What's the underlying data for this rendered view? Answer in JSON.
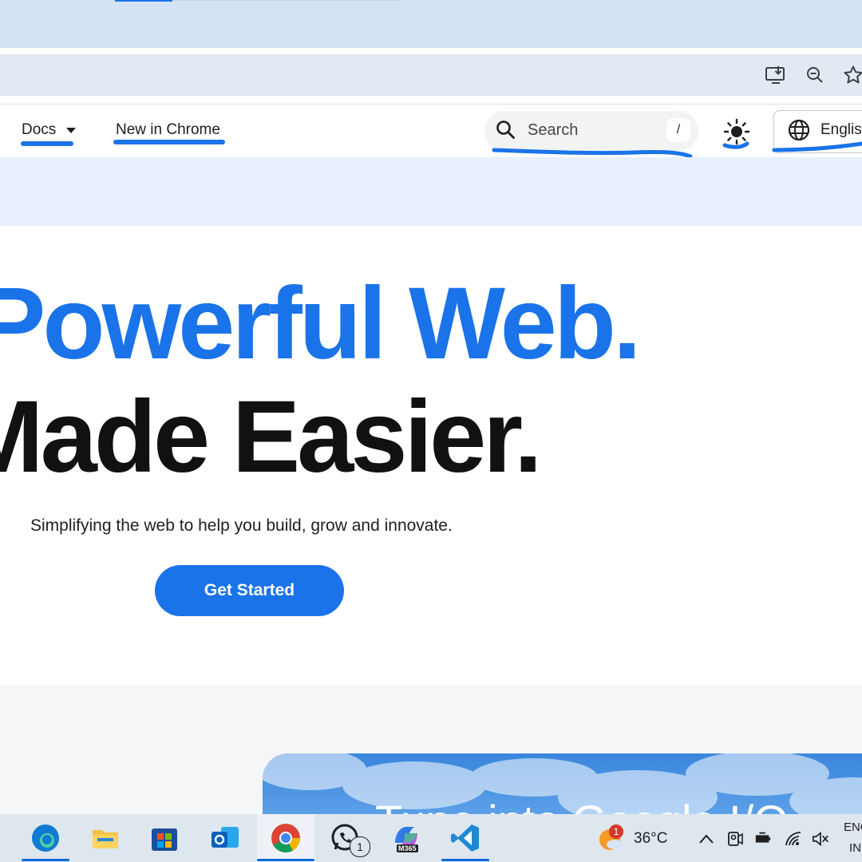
{
  "nav": {
    "docs_label": "Docs",
    "new_in_chrome_label": "New in Chrome",
    "search_placeholder": "Search",
    "search_shortcut": "/",
    "language_label": "Englis"
  },
  "hero": {
    "line1": "Powerful Web.",
    "line2": "Made Easier.",
    "subtitle": "Simplifying the web to help you build, grow and innovate.",
    "cta_label": "Get Started"
  },
  "promo": {
    "partial_text": "Tune into Google I/O"
  },
  "taskbar": {
    "whatsapp_badge": "1",
    "m365_label": "M365",
    "weather_badge": "1",
    "temperature": "36°C",
    "input_lang_line1": "ENG",
    "input_lang_line2": "IN",
    "apps": [
      "edge-icon",
      "file-explorer-icon",
      "microsoft-store-icon",
      "outlook-icon",
      "chrome-icon",
      "whatsapp-icon",
      "m365-copilot-icon",
      "vscode-icon"
    ]
  },
  "colors": {
    "accent": "#1a73e8",
    "annotation": "#1a73e8",
    "tabstrip": "#d3e3f5",
    "taskbar": "#dee6ee"
  }
}
